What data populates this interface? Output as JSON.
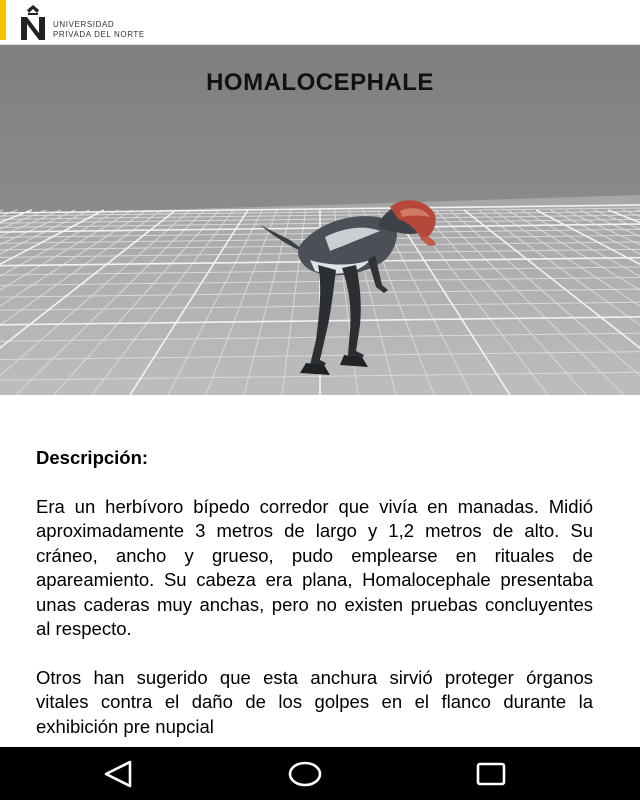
{
  "header": {
    "logo_line1": "UNIVERSIDAD",
    "logo_line2": "PRIVADA DEL NORTE",
    "accent_color": "#f2c500"
  },
  "viewer": {
    "title": "HOMALOCEPHALE",
    "model": "dinosaur-3d-model"
  },
  "content": {
    "heading": "Descripción:",
    "paragraphs": [
      "Era un herbívoro bípedo corredor que vivía en manadas. Midió aproximadamente 3 metros de largo y 1,2 metros de alto. Su cráneo, ancho y grueso, pudo emplearse en rituales de apareamiento. Su cabeza era plana, Homalocephale presentaba unas caderas muy anchas, pero no existen pruebas concluyentes al respecto.",
      "Otros han sugerido que esta anchura sirvió proteger órganos vitales contra el daño de los golpes en el flanco durante la exhibición pre nupcial"
    ]
  },
  "navbar": {
    "back_icon": "back-triangle-icon",
    "home_icon": "home-circle-icon",
    "recents_icon": "recents-square-icon"
  }
}
